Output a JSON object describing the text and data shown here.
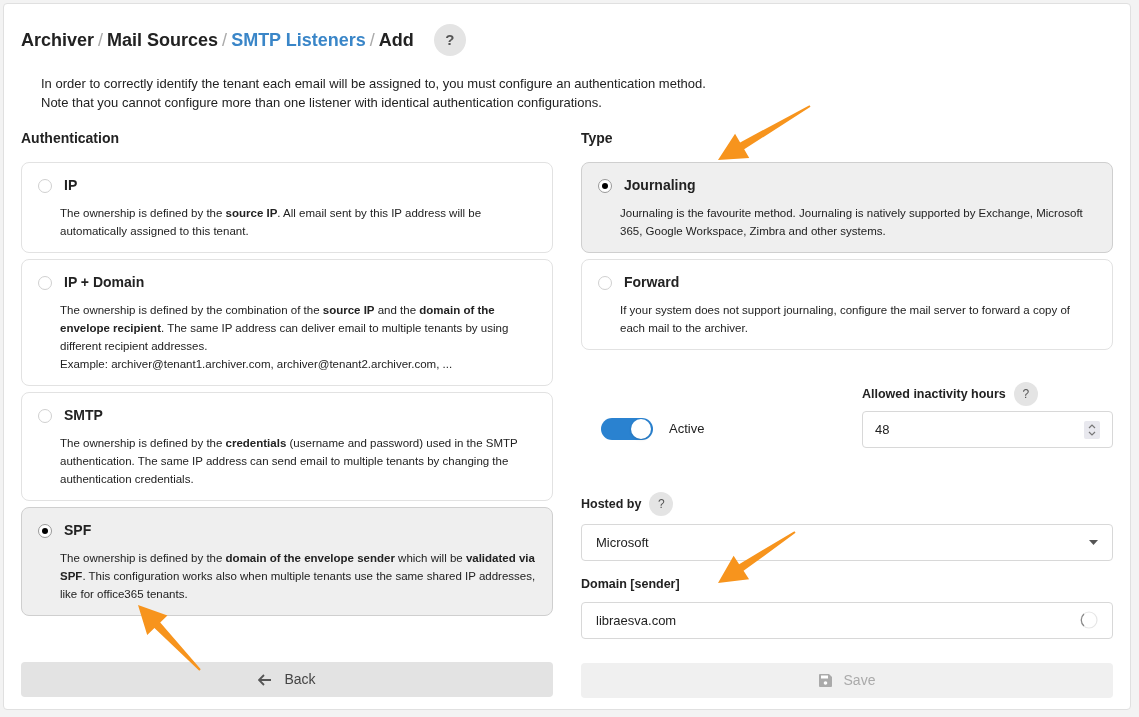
{
  "breadcrumb": [
    {
      "label": "Archiver",
      "kind": "text"
    },
    {
      "label": "Mail Sources",
      "kind": "text"
    },
    {
      "label": "SMTP Listeners",
      "kind": "link"
    },
    {
      "label": "Add",
      "kind": "text"
    }
  ],
  "breadcrumb_separator": "/",
  "help_button": "?",
  "intro": [
    "In order to correctly identify the tenant each email will be assigned to, you must configure an authentication method.",
    "Note that you cannot configure more than one listener with identical authentication configurations."
  ],
  "authentication": {
    "title": "Authentication",
    "options": [
      {
        "label": "IP",
        "selected": false,
        "description": "The ownership is defined by the **source IP**. All email sent by this IP address will be automatically assigned to this tenant."
      },
      {
        "label": "IP + Domain",
        "selected": false,
        "description": "The ownership is defined by the combination of the **source IP** and the **domain of the envelope recipient**. The same IP address can deliver email to multiple tenants by using different recipient addresses.",
        "example": "Example: archiver@tenant1.archiver.com, archiver@tenant2.archiver.com, ..."
      },
      {
        "label": "SMTP",
        "selected": false,
        "description": "The ownership is defined by the **credentials** (username and password) used in the SMTP authentication. The same IP address can send email to multiple tenants by changing the authentication credentials."
      },
      {
        "label": "SPF",
        "selected": true,
        "description": "The ownership is defined by the **domain of the envelope sender** which will be **validated via SPF**. This configuration works also when multiple tenants use the same shared IP addresses, like for office365 tenants."
      }
    ]
  },
  "type": {
    "title": "Type",
    "options": [
      {
        "label": "Journaling",
        "selected": true,
        "description": "Journaling is the favourite method. Journaling is natively supported by Exchange, Microsoft 365, Google Workspace, Zimbra and other systems."
      },
      {
        "label": "Forward",
        "selected": false,
        "description": "If your system does not support journaling, configure the mail server to forward a copy of each mail to the archiver."
      }
    ]
  },
  "active": {
    "label": "Active",
    "on": true
  },
  "inactivity": {
    "label": "Allowed inactivity hours",
    "help": "?",
    "value": "48"
  },
  "hosted_by": {
    "label": "Hosted by",
    "help": "?",
    "value": "Microsoft"
  },
  "domain": {
    "label": "Domain [sender]",
    "value": "libraesva.com"
  },
  "back_button": {
    "label": "Back"
  },
  "save_button": {
    "label": "Save",
    "disabled": true
  }
}
